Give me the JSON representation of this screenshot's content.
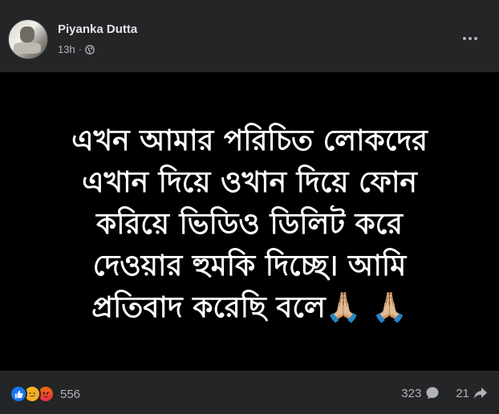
{
  "post": {
    "author": "Piyanka Dutta",
    "time": "13h",
    "separator": "·",
    "privacy_icon": "globe-icon",
    "more_icon": "more-options-icon",
    "text_lines": [
      "এখন আমার পরিচিত লোকদের",
      "এখান দিয়ে ওখান দিয়ে ফোন",
      "করিয়ে ভিডিও ডিলিট করে",
      "দেওয়ার হুমকি দিচ্ছে। আমি",
      "প্রতিবাদ করেছি বলে🙏🏼 🙏🏼"
    ]
  },
  "footer": {
    "reaction_icons": [
      "like-icon",
      "sad-icon",
      "angry-icon"
    ],
    "reaction_count": "556",
    "comment_count": "323",
    "share_count": "21"
  },
  "colors": {
    "background": "#242526",
    "image_background": "#000000",
    "text_primary": "#e4e6eb",
    "text_secondary": "#b0b3b8",
    "like_blue": "#1877f2"
  }
}
